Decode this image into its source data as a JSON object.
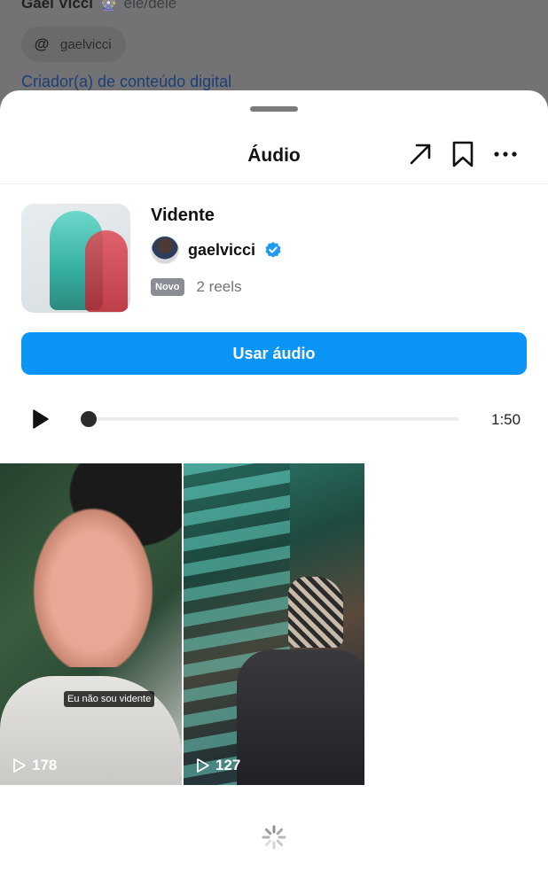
{
  "background_profile": {
    "name": "Gael Vicci",
    "emoji": "🎡",
    "pronouns": "ele/dele",
    "threads_handle": "gaelvicci",
    "category": "Criador(a) de conteúdo digital"
  },
  "sheet": {
    "title": "Áudio",
    "header_icons": [
      "share-arrow-icon",
      "bookmark-icon",
      "more-icon"
    ]
  },
  "audio": {
    "title": "Vidente",
    "artist": "gaelvicci",
    "verified": true,
    "badge": "Novo",
    "reels_count": "2 reels",
    "use_button": "Usar áudio",
    "duration": "1:50",
    "progress": 0.0
  },
  "reels": [
    {
      "caption": "Eu não sou vidente",
      "views": "178"
    },
    {
      "caption": "",
      "views": "127"
    }
  ],
  "colors": {
    "accent": "#0a95f6",
    "verified": "#1d9bf0"
  }
}
